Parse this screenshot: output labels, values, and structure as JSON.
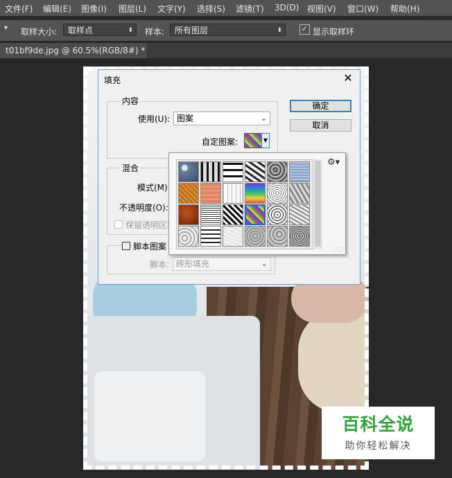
{
  "menu": [
    "文件(F)",
    "编辑(E)",
    "图像(I)",
    "图层(L)",
    "文字(Y)",
    "选择(S)",
    "滤镜(T)",
    "3D(D)",
    "视图(V)",
    "窗口(W)",
    "帮助(H)"
  ],
  "options_bar": {
    "sample_size_label": "取样大小:",
    "sample_size_value": "取样点",
    "sample_label": "样本:",
    "sample_value": "所有图层",
    "show_ring_label": "显示取样环",
    "show_ring_checked": true
  },
  "document_tab": {
    "title": "t01bf9de.jpg @ 60.5%(RGB/8#) *"
  },
  "fill_dialog": {
    "title": "填充",
    "ok_label": "确定",
    "cancel_label": "取消",
    "contents": {
      "group_label": "内容",
      "use_label": "使用(U):",
      "use_value": "图案",
      "custom_pattern_label": "自定图案:"
    },
    "blending": {
      "group_label": "混合",
      "mode_label": "模式(M):",
      "opacity_label": "不透明度(O):",
      "preserve_transparency_label": "保留透明区域"
    },
    "script": {
      "checkbox_label": "脚本图案",
      "script_label": "脚本:",
      "script_value": "砖形填充"
    }
  },
  "pattern_picker": {
    "selected_index": 15,
    "gear_icon": "gear-icon",
    "patterns": [
      "bubbles",
      "wood-grid",
      "stones-bw",
      "zebra",
      "gravel",
      "blue-cloth",
      "orange-weave",
      "peach-tile",
      "white-grid",
      "rainbow",
      "speckle",
      "rock-gray",
      "rust",
      "concentric-squares",
      "checker",
      "color-noise",
      "black-dots",
      "crystal",
      "marble",
      "wave-bw",
      "light-paper",
      "gray-pebbles",
      "gray-stones",
      "granite"
    ]
  },
  "watermark": {
    "title": "百科全说",
    "subtitle": "助你轻松解决"
  },
  "colors": {
    "accent": "#3c7fb1",
    "watermark_green": "#31a23a",
    "ui_dark": "#535353"
  }
}
